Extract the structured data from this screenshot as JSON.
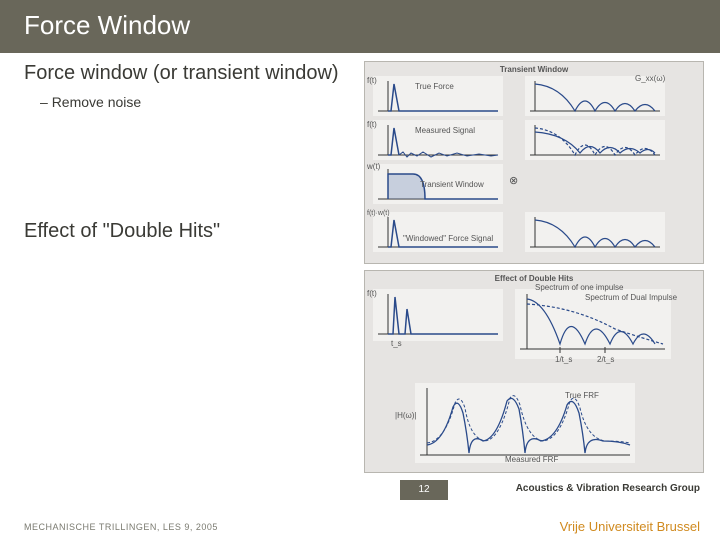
{
  "title": "Force Window",
  "section1": {
    "heading": "Force window (or transient window)",
    "bullet1": "Remove noise"
  },
  "section2": {
    "heading": "Effect of \"Double Hits\""
  },
  "figure1": {
    "caption_top": "Transient Window",
    "label_a": "f(t)",
    "label_b": "True Force",
    "label_c": "G_xx(ω)",
    "label_d": "Measured Signal",
    "label_e": "w(t)",
    "label_f": "Transient Window",
    "label_g": "f(t)·w(t)",
    "label_h": "\"Windowed\" Force Signal"
  },
  "figure2": {
    "caption_top": "Effect of Double Hits",
    "label_a": "f(t)",
    "label_b": "Spectrum of one impulse",
    "label_c": "Spectrum of Dual Impulse",
    "label_d": "t_s",
    "label_e": "1/t_s",
    "label_f": "2/t_s",
    "label_g": "True FRF",
    "label_h": "|H(ω)|",
    "label_i": "Measured FRF"
  },
  "footer": {
    "page": "12",
    "group": "Acoustics & Vibration Research Group",
    "course": "MECHANISCHE TRILLINGEN, LES 9, 2005",
    "university": "Vrije Universiteit Brussel"
  }
}
